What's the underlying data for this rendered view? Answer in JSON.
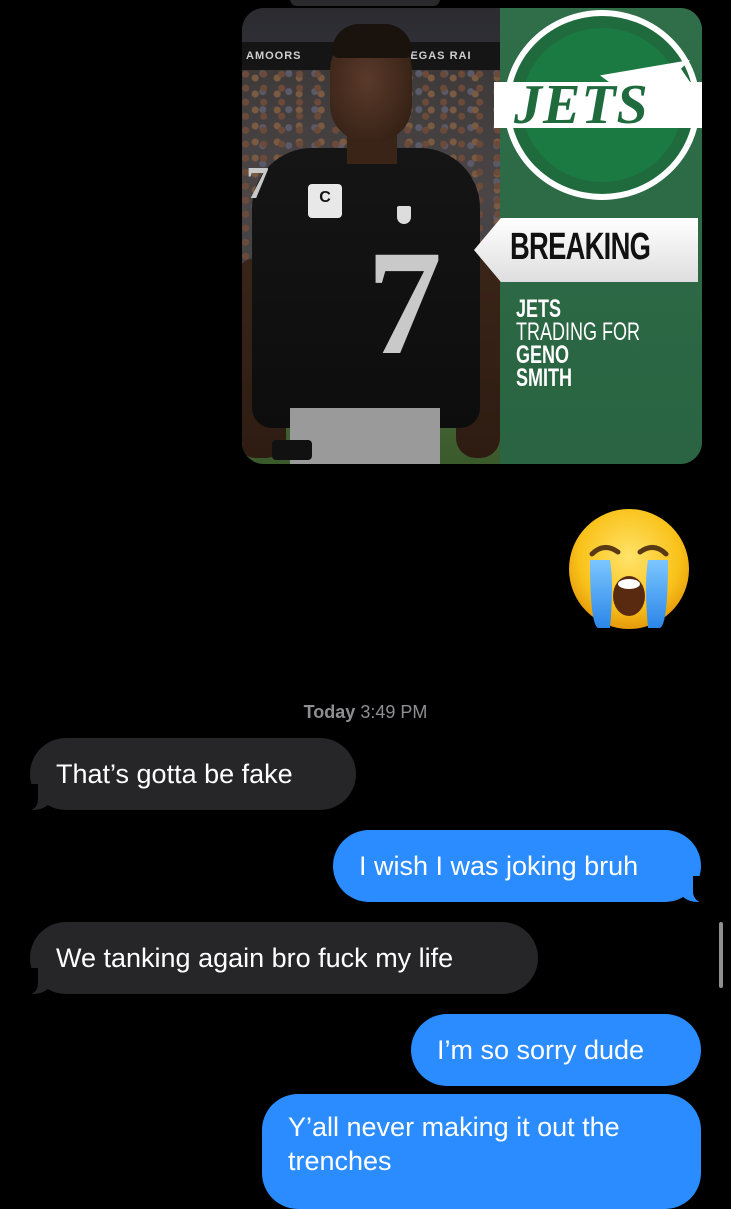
{
  "attachment": {
    "stadium_text_left": "AMOORS",
    "stadium_text_right": "VEGAS RAI",
    "jersey_number": "7",
    "shoulder_number": "7",
    "captain_patch": "C",
    "team_word": "JETS",
    "breaking_label": "BREAKING",
    "headline_lines": [
      "JETS",
      "TRADING FOR",
      "GENO",
      "SMITH"
    ]
  },
  "emoji": {
    "name": "loudly-crying-face",
    "glyph": "😭"
  },
  "timestamp": {
    "day": "Today",
    "time": "3:49 PM"
  },
  "messages": [
    {
      "direction": "received",
      "text": "That’s gotta be fake"
    },
    {
      "direction": "sent",
      "text": "I wish I was joking bruh"
    },
    {
      "direction": "received",
      "text": "We tanking again bro fuck my life"
    },
    {
      "direction": "sent",
      "text": "I’m so sorry dude"
    },
    {
      "direction": "sent",
      "text": "Y’all never making it out the trenches"
    }
  ],
  "colors": {
    "background": "#000000",
    "received_bubble": "#262628",
    "sent_bubble": "#2b8cff",
    "jets_green": "#1f6b3e",
    "timestamp_gray": "#8e8e93"
  }
}
